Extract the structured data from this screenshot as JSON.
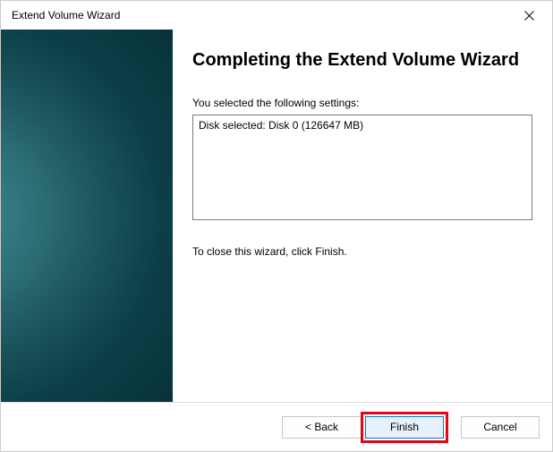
{
  "titlebar": {
    "title": "Extend Volume Wizard"
  },
  "main": {
    "heading": "Completing the Extend Volume Wizard",
    "intro": "You selected the following settings:",
    "settings_summary": "Disk selected: Disk 0 (126647 MB)",
    "instruction": "To close this wizard, click Finish."
  },
  "buttons": {
    "back": "< Back",
    "finish": "Finish",
    "cancel": "Cancel"
  }
}
